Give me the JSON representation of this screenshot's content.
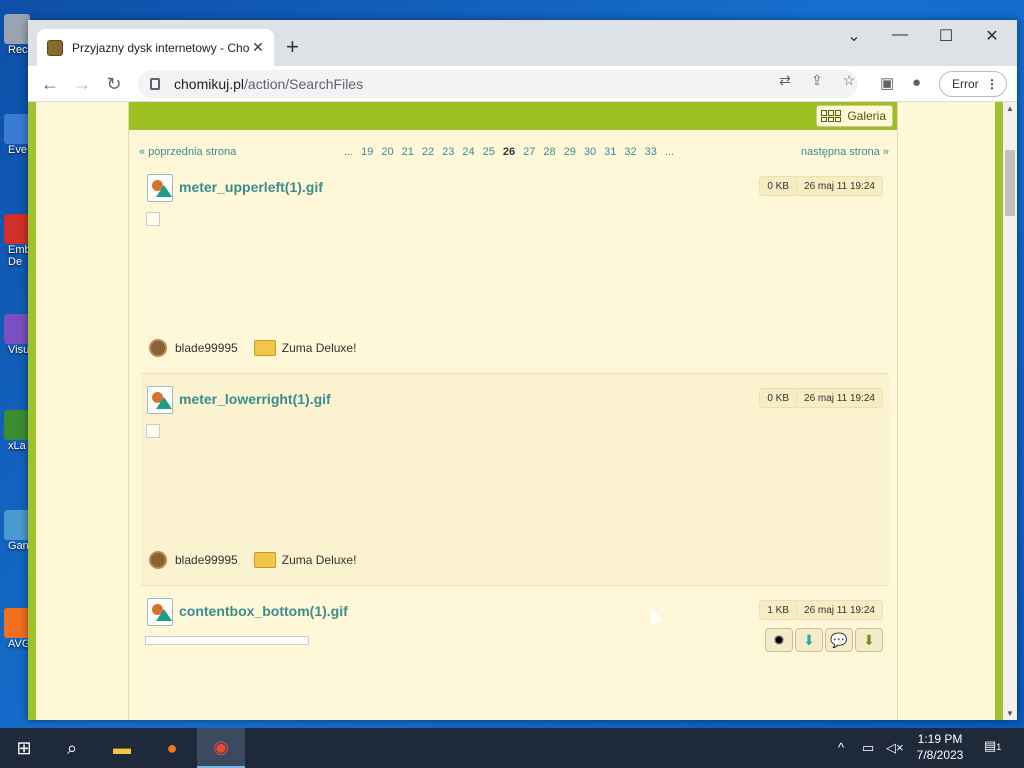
{
  "desktop": {
    "icons": [
      {
        "label": "Rec",
        "color": "#9aa4b0"
      },
      {
        "label": "Eve",
        "color": "#3a7bd5"
      },
      {
        "label": "Emb",
        "color": "#d0302a"
      },
      {
        "label": "De",
        "color": "#d0302a"
      },
      {
        "label": "Visu",
        "color": "#7b4fc0"
      },
      {
        "label": "xLa",
        "color": "#3b8d30"
      },
      {
        "label": "Gan",
        "color": "#4a9ad0"
      },
      {
        "label": "AVG",
        "color": "#f07020"
      }
    ]
  },
  "browser": {
    "tab_title": "Przyjazny dysk internetowy - Cho",
    "tab_close": "✕",
    "new_tab": "+",
    "url_host": "chomikuj.pl",
    "url_path": "/action/SearchFiles",
    "error_label": "Error",
    "error_menu": "⋮",
    "win_min": "—",
    "win_max": "☐",
    "win_close": "✕",
    "win_chevron": "⌄"
  },
  "page": {
    "galeria_label": "Galeria",
    "pager": {
      "prev": "« poprzednia strona",
      "next": "następna strona »",
      "leading_ellipsis": "...",
      "pages": [
        "19",
        "20",
        "21",
        "22",
        "23",
        "24",
        "25",
        "26",
        "27",
        "28",
        "29",
        "30",
        "31",
        "32",
        "33"
      ],
      "current": "26",
      "trailing_ellipsis": "..."
    },
    "files": [
      {
        "name": "meter_upperleft(1).gif",
        "size": "0 KB",
        "date": "26 maj 11 19:24",
        "owner": "blade99995",
        "folder": "Zuma Deluxe!"
      },
      {
        "name": "meter_lowerright(1).gif",
        "size": "0 KB",
        "date": "26 maj 11 19:24",
        "owner": "blade99995",
        "folder": "Zuma Deluxe!"
      },
      {
        "name": "contentbox_bottom(1).gif",
        "size": "1 KB",
        "date": "26 maj 11 19:24"
      }
    ]
  },
  "taskbar": {
    "time": "1:19 PM",
    "date": "7/8/2023",
    "notification_count": "1"
  }
}
